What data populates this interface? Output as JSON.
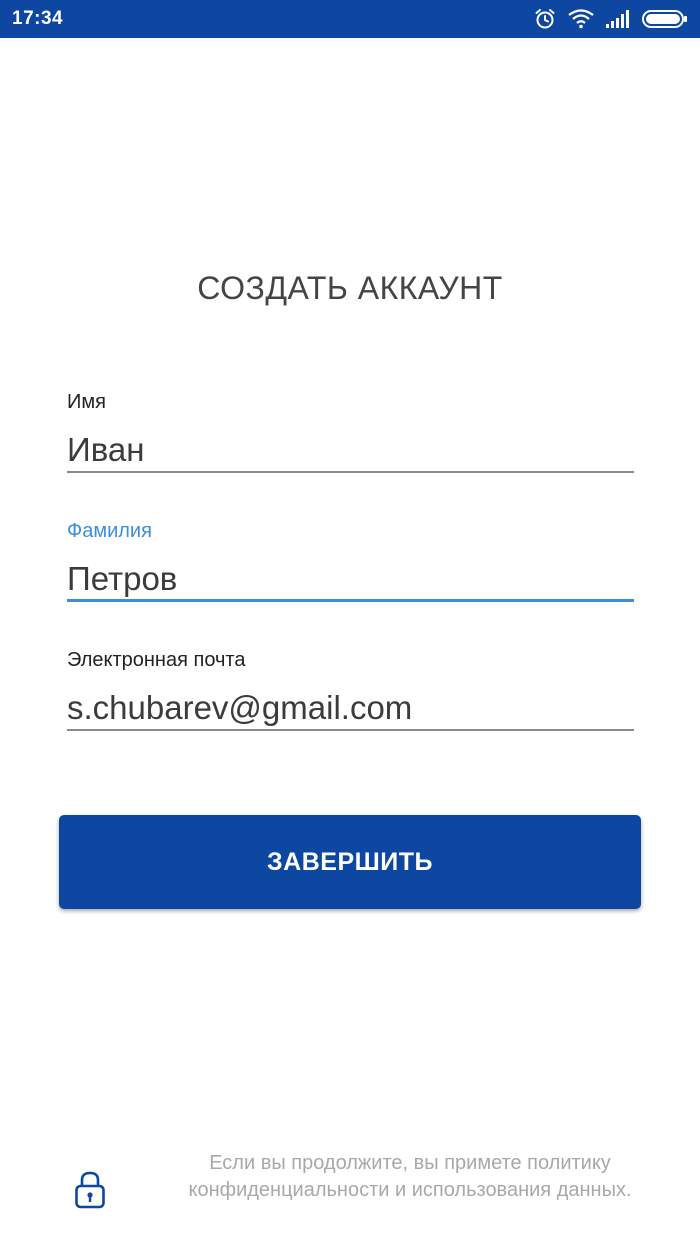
{
  "status_bar": {
    "time": "17:34",
    "icons": [
      "alarm-clock-icon",
      "wifi-icon",
      "signal-icon",
      "battery-icon"
    ]
  },
  "page": {
    "title": "СОЗДАТЬ АККАУНТ"
  },
  "form": {
    "first_name": {
      "label": "Имя",
      "value": "Иван"
    },
    "last_name": {
      "label": "Фамилия",
      "value": "Петров",
      "focused": true
    },
    "email": {
      "label": "Электронная почта",
      "value": "s.chubarev@gmail.com"
    }
  },
  "actions": {
    "finish_label": "ЗАВЕРШИТЬ"
  },
  "footer": {
    "privacy_text": "Если вы продолжите, вы примете политику конфиденциальности и использования данных.",
    "icon": "lock-icon"
  },
  "colors": {
    "primary": "#0d47a1",
    "focus_accent": "#3a8fd8",
    "muted_text": "#a8a8a8"
  }
}
